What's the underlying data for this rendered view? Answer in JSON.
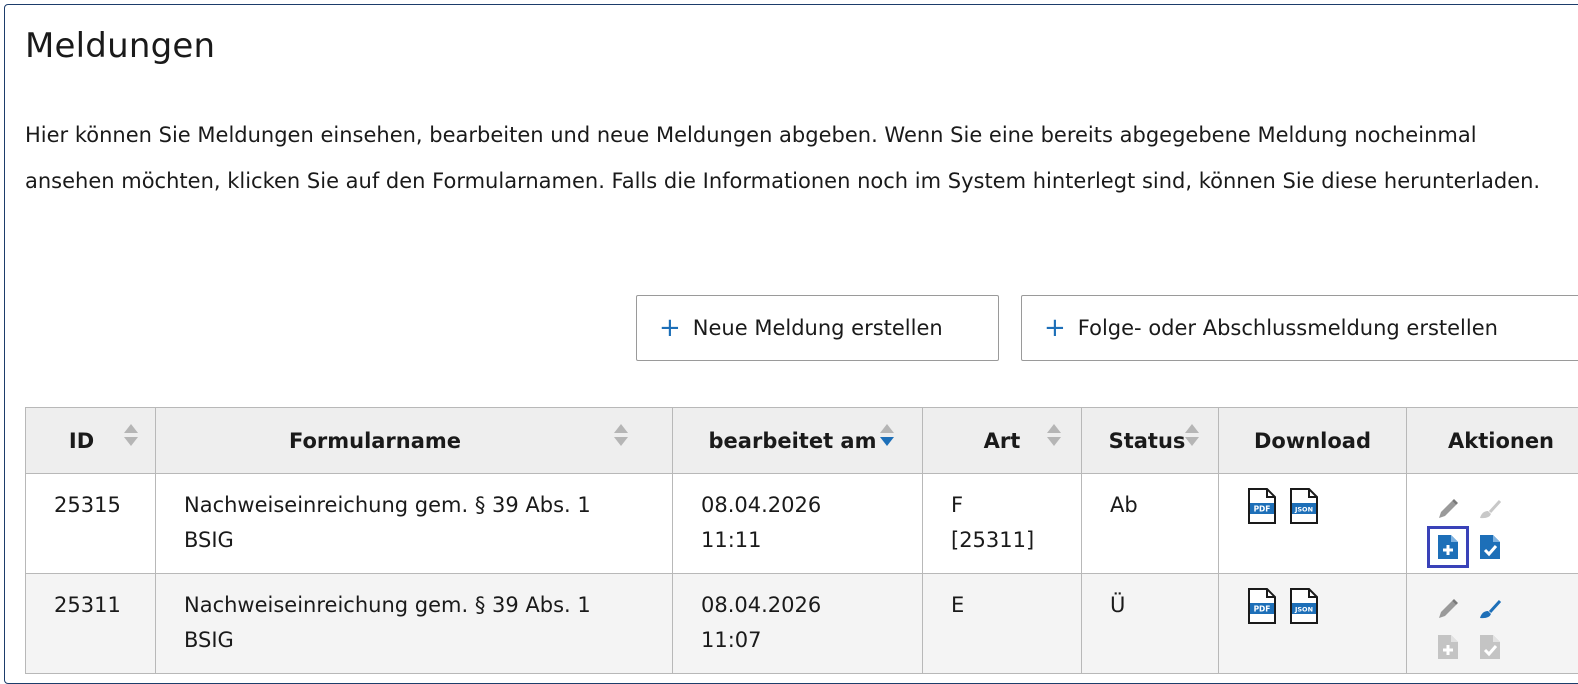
{
  "page": {
    "title": "Meldungen",
    "intro": "Hier können Sie Meldungen einsehen, bearbeiten und neue Meldungen abgeben. Wenn Sie eine bereits abgegebene Meldung nocheinmal ansehen möchten, klicken Sie auf den Formularnamen. Falls die Informationen noch im System hinterlegt sind, können Sie diese herunterladen."
  },
  "toolbar": {
    "new_label": "Neue Meldung erstellen",
    "follow_label": "Folge- oder Abschlussmeldung erstellen",
    "plus_icon": "plus-icon"
  },
  "table": {
    "headers": {
      "id": "ID",
      "form": "Formularname",
      "edited": "bearbeitet am",
      "type": "Art",
      "status": "Status",
      "download": "Download",
      "actions": "Aktionen"
    },
    "sorted_column": "bearbeitet am",
    "sort_direction": "descending",
    "rows": [
      {
        "id": "25315",
        "form_line1": "Nachweiseinreichung gem. § 39 Abs. 1",
        "form_line2": "BSIG",
        "date": "08.04.2026",
        "time": "11:11",
        "type_line1": "F",
        "type_line2": "[25311]",
        "status": "Ab"
      },
      {
        "id": "25311",
        "form_line1": "Nachweiseinreichung gem. § 39 Abs. 1",
        "form_line2": "BSIG",
        "date": "08.04.2026",
        "time": "11:07",
        "type_line1": "E",
        "type_line2": "",
        "status": "Ü"
      }
    ],
    "download_icons": [
      "pdf-file-icon",
      "json-file-icon"
    ],
    "pdf_badge": "PDF",
    "json_badge": "JSON",
    "action_icons": [
      "edit-pencil-icon",
      "clean-brush-icon",
      "add-document-icon",
      "approve-document-icon"
    ]
  },
  "colors": {
    "accent_blue": "#1d6fb8",
    "highlight": "#3a42b8",
    "header_bg": "#eeeeee",
    "border": "#b8b8b8",
    "disabled_icon": "#b5b5b5"
  }
}
